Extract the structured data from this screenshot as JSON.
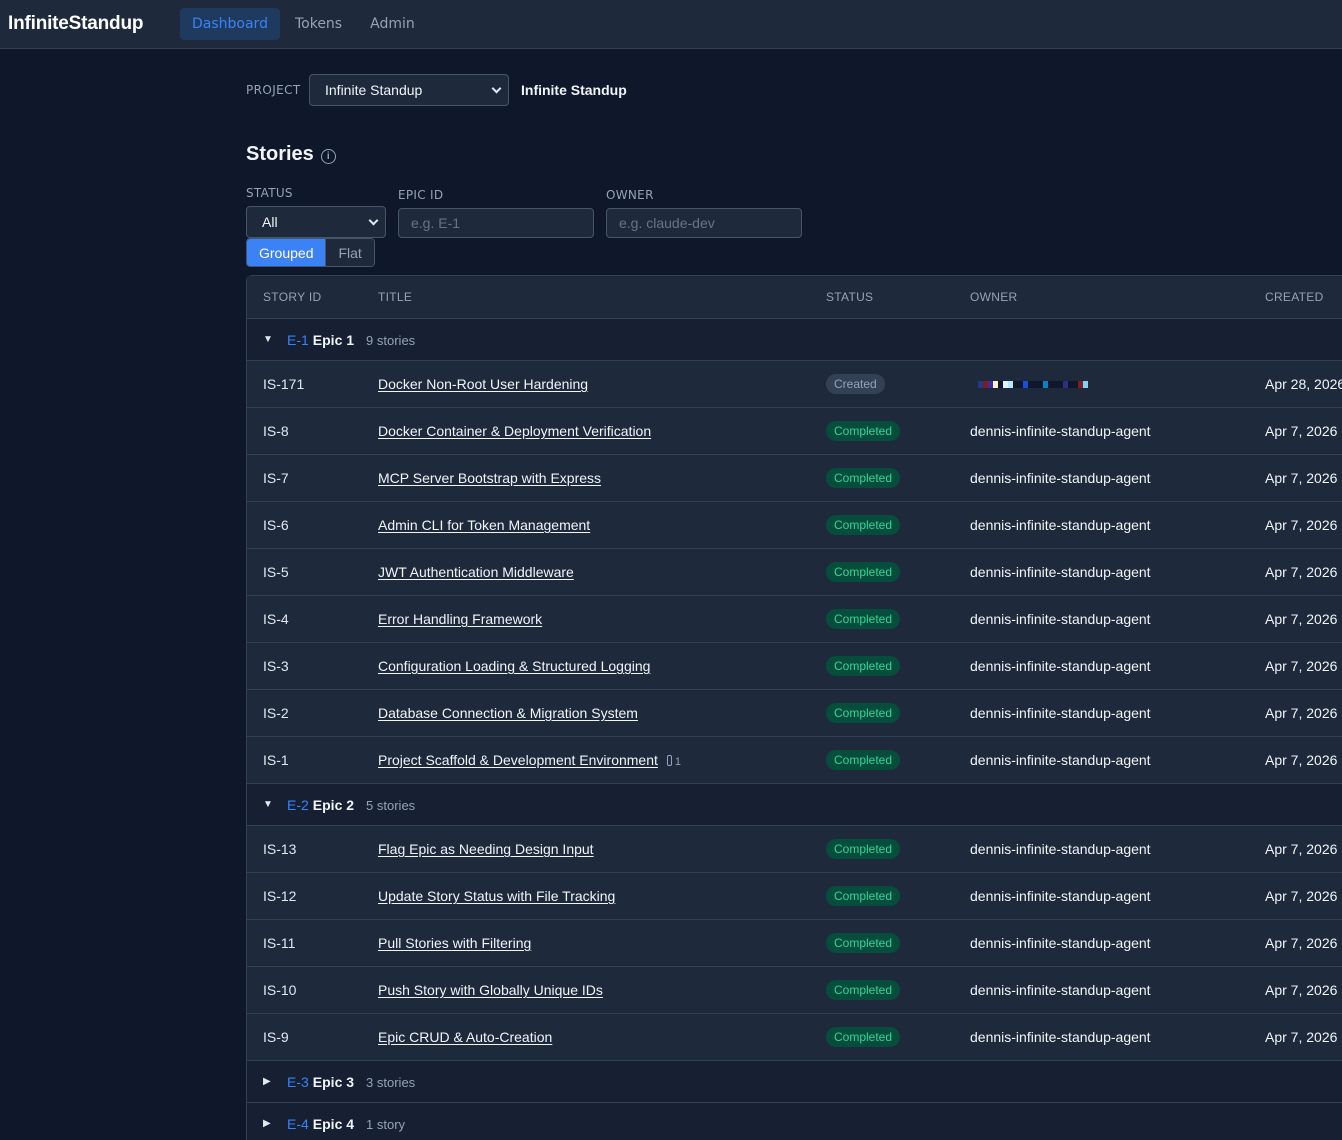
{
  "app": {
    "brand": "InfiniteStandup",
    "nav": [
      {
        "label": "Dashboard",
        "active": true
      },
      {
        "label": "Tokens",
        "active": false
      },
      {
        "label": "Admin",
        "active": false
      }
    ]
  },
  "project": {
    "label": "PROJECT",
    "selected": "Infinite Standup",
    "name": "Infinite Standup"
  },
  "stories": {
    "heading": "Stories",
    "info_icon": "info-icon",
    "filters": {
      "status_label": "STATUS",
      "status_value": "All",
      "epic_label": "EPIC ID",
      "epic_placeholder": "e.g. E-1",
      "owner_label": "OWNER",
      "owner_placeholder": "e.g. claude-dev"
    },
    "view_toggle": {
      "grouped": "Grouped",
      "flat": "Flat",
      "active": "Grouped"
    },
    "columns": {
      "story_id": "STORY ID",
      "title": "TITLE",
      "status": "STATUS",
      "owner": "OWNER",
      "created": "CREATED"
    },
    "groups": [
      {
        "id": "E-1",
        "name": "Epic 1",
        "count": "9 stories",
        "expanded": true,
        "arrow": "▼",
        "rows": [
          {
            "id": "IS-171",
            "title": "Docker Non-Root User Hardening",
            "status": "Created",
            "owner": "",
            "created": "Apr 28, 2026"
          },
          {
            "id": "IS-8",
            "title": "Docker Container & Deployment Verification",
            "status": "Completed",
            "owner": "dennis-infinite-standup-agent",
            "created": "Apr 7, 2026"
          },
          {
            "id": "IS-7",
            "title": "MCP Server Bootstrap with Express",
            "status": "Completed",
            "owner": "dennis-infinite-standup-agent",
            "created": "Apr 7, 2026"
          },
          {
            "id": "IS-6",
            "title": "Admin CLI for Token Management",
            "status": "Completed",
            "owner": "dennis-infinite-standup-agent",
            "created": "Apr 7, 2026"
          },
          {
            "id": "IS-5",
            "title": "JWT Authentication Middleware",
            "status": "Completed",
            "owner": "dennis-infinite-standup-agent",
            "created": "Apr 7, 2026"
          },
          {
            "id": "IS-4",
            "title": "Error Handling Framework",
            "status": "Completed",
            "owner": "dennis-infinite-standup-agent",
            "created": "Apr 7, 2026"
          },
          {
            "id": "IS-3",
            "title": "Configuration Loading & Structured Logging",
            "status": "Completed",
            "owner": "dennis-infinite-standup-agent",
            "created": "Apr 7, 2026"
          },
          {
            "id": "IS-2",
            "title": "Database Connection & Migration System",
            "status": "Completed",
            "owner": "dennis-infinite-standup-agent",
            "created": "Apr 7, 2026"
          },
          {
            "id": "IS-1",
            "title": "Project Scaffold & Development Environment",
            "status": "Completed",
            "owner": "dennis-infinite-standup-agent",
            "created": "Apr 7, 2026",
            "attachments": "1"
          }
        ]
      },
      {
        "id": "E-2",
        "name": "Epic 2",
        "count": "5 stories",
        "expanded": true,
        "arrow": "▼",
        "rows": [
          {
            "id": "IS-13",
            "title": "Flag Epic as Needing Design Input",
            "status": "Completed",
            "owner": "dennis-infinite-standup-agent",
            "created": "Apr 7, 2026"
          },
          {
            "id": "IS-12",
            "title": "Update Story Status with File Tracking",
            "status": "Completed",
            "owner": "dennis-infinite-standup-agent",
            "created": "Apr 7, 2026"
          },
          {
            "id": "IS-11",
            "title": "Pull Stories with Filtering",
            "status": "Completed",
            "owner": "dennis-infinite-standup-agent",
            "created": "Apr 7, 2026"
          },
          {
            "id": "IS-10",
            "title": "Push Story with Globally Unique IDs",
            "status": "Completed",
            "owner": "dennis-infinite-standup-agent",
            "created": "Apr 7, 2026"
          },
          {
            "id": "IS-9",
            "title": "Epic CRUD & Auto-Creation",
            "status": "Completed",
            "owner": "dennis-infinite-standup-agent",
            "created": "Apr 7, 2026"
          }
        ]
      },
      {
        "id": "E-3",
        "name": "Epic 3",
        "count": "3 stories",
        "expanded": false,
        "arrow": "▶",
        "rows": []
      },
      {
        "id": "E-4",
        "name": "Epic 4",
        "count": "1 story",
        "expanded": false,
        "arrow": "▶",
        "rows": []
      }
    ]
  },
  "colors": {
    "accent": "#3b82f6",
    "completed_bg": "#064e3b",
    "completed_fg": "#34d399",
    "created_bg": "#334155",
    "created_fg": "#94a3b8",
    "owner_glyph_colors": [
      "#1e3a8a",
      "#7f1d1d",
      "#3730a3",
      "#fef3c7",
      "#0f172a",
      "#e0f2fe",
      "#bae6fd",
      "#0f172a",
      "#0f172a",
      "#1d4ed8",
      "#0f172a",
      "#0f172a",
      "#0f172a",
      "#0284c7",
      "#0f172a",
      "#0f172a",
      "#0f172a",
      "#312e81",
      "#0f172a",
      "#0f172a",
      "#7f1d1d",
      "#7dd3fc"
    ]
  }
}
